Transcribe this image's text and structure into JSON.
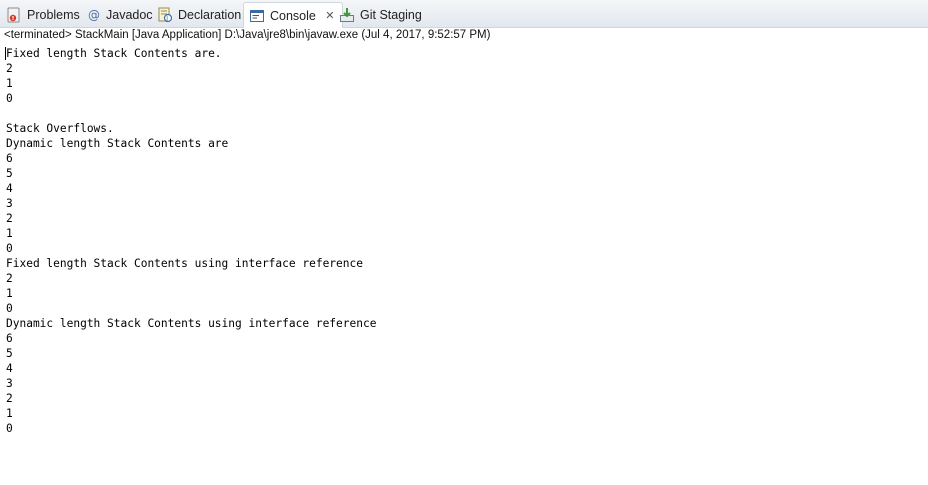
{
  "tabs": [
    {
      "label": "Problems",
      "icon": "problems-icon"
    },
    {
      "label": "Javadoc",
      "icon": "javadoc-icon"
    },
    {
      "label": "Declaration",
      "icon": "declaration-icon"
    },
    {
      "label": "Console",
      "icon": "console-icon",
      "active": true
    },
    {
      "label": "Git Staging",
      "icon": "git-staging-icon"
    }
  ],
  "console": {
    "status": "<terminated> StackMain [Java Application] D:\\Java\\jre8\\bin\\javaw.exe (Jul 4, 2017, 9:52:57 PM)",
    "lines": [
      "Fixed length Stack Contents are.",
      "2",
      "1",
      "0",
      "",
      "Stack Overflows.",
      "Dynamic length Stack Contents are",
      "6",
      "5",
      "4",
      "3",
      "2",
      "1",
      "0",
      "Fixed length Stack Contents using interface reference",
      "2",
      "1",
      "0",
      "Dynamic length Stack Contents using interface reference",
      "6",
      "5",
      "4",
      "3",
      "2",
      "1",
      "0"
    ]
  }
}
